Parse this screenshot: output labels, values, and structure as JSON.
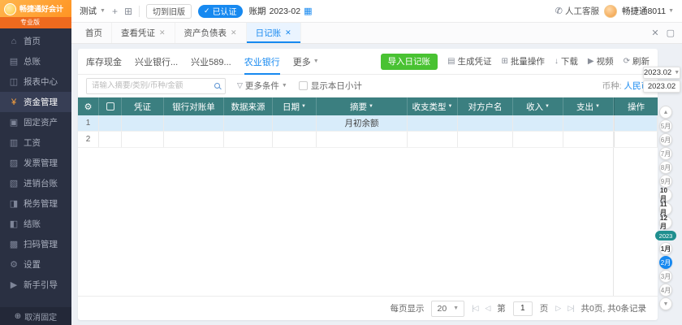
{
  "colors": {
    "accent_blue": "#1789f0",
    "brand_orange": "#ff9423",
    "sidebar_bg": "#2a3042",
    "table_header_teal": "#3b7f80",
    "import_green": "#49c232",
    "selected_row_blue": "#d8ecfa"
  },
  "sidebar": {
    "brand": {
      "title": "畅捷通好会计",
      "edition": "专业版"
    },
    "items": [
      {
        "label": "首页"
      },
      {
        "label": "总账"
      },
      {
        "label": "报表中心"
      },
      {
        "label": "资金管理"
      },
      {
        "label": "固定资产"
      },
      {
        "label": "工资"
      },
      {
        "label": "发票管理"
      },
      {
        "label": "进销台账"
      },
      {
        "label": "税务管理"
      },
      {
        "label": "结账"
      },
      {
        "label": "扫码管理"
      },
      {
        "label": "设置"
      },
      {
        "label": "新手引导"
      }
    ],
    "unpin_label": "取消固定"
  },
  "topbar": {
    "org_name": "测试",
    "switch_old_label": "切到旧版",
    "certified_label": "已认证",
    "period_label": "账期",
    "period_value": "2023-02",
    "service_label": "人工客服",
    "username": "畅捷通8011"
  },
  "tabbar": {
    "tabs": [
      {
        "label": "首页"
      },
      {
        "label": "查看凭证"
      },
      {
        "label": "资产负债表"
      },
      {
        "label": "日记账"
      }
    ]
  },
  "account_tabs": [
    {
      "label": "库存现金"
    },
    {
      "label": "兴业银行..."
    },
    {
      "label": "兴业589..."
    },
    {
      "label": "农业银行"
    },
    {
      "label": "更多"
    }
  ],
  "toolbar": {
    "import_label": "导入日记账",
    "gen_voucher_label": "生成凭证",
    "batch_label": "批量操作",
    "download_label": "下载",
    "video_label": "视频",
    "refresh_label": "刷新"
  },
  "filter": {
    "search_placeholder": "请输入摘要/类别/币种/金额",
    "more_label": "更多条件",
    "subtotal_label": "显示本日小计",
    "currency_label": "币种:",
    "currency_value": "人民币"
  },
  "table": {
    "columns": [
      {
        "label": "凭证"
      },
      {
        "label": "银行对账单"
      },
      {
        "label": "数据来源"
      },
      {
        "label": "日期"
      },
      {
        "label": "摘要"
      },
      {
        "label": "收支类型"
      },
      {
        "label": "对方户名"
      },
      {
        "label": "收入"
      },
      {
        "label": "支出"
      },
      {
        "label": "操作"
      }
    ],
    "rows": [
      {
        "num": "1",
        "summary": "月初余额"
      },
      {
        "num": "2",
        "summary": ""
      }
    ]
  },
  "pagination": {
    "per_page_label": "每页显示",
    "per_page_value": "20",
    "page_prefix": "第",
    "page_value": "1",
    "page_suffix": "页",
    "total_text": "共0页, 共0条记录"
  },
  "date_rail": {
    "period_current": "2023.02",
    "period_option": "2023.02",
    "year_badge": "2023",
    "months": [
      {
        "label": "5月"
      },
      {
        "label": "6月"
      },
      {
        "label": "7月"
      },
      {
        "label": "8月"
      },
      {
        "label": "9月"
      },
      {
        "label": "10月"
      },
      {
        "label": "11月"
      },
      {
        "label": "12月"
      },
      {
        "label": "1月"
      },
      {
        "label": "2月"
      },
      {
        "label": "3月"
      },
      {
        "label": "4月"
      }
    ]
  }
}
